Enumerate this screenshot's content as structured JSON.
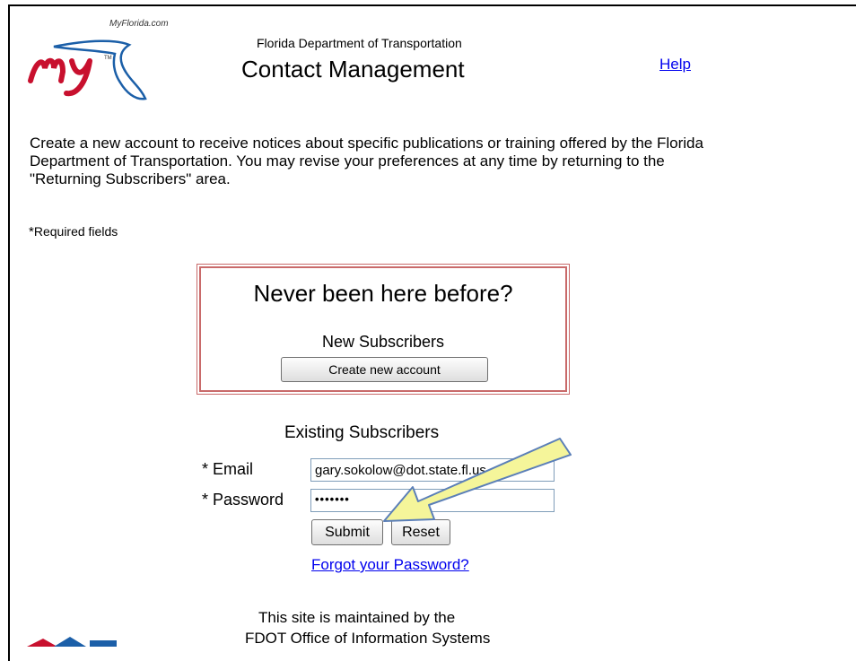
{
  "header": {
    "logo_site": "MyFlorida.com",
    "agency": "Florida Department of Transportation",
    "title": "Contact Management",
    "help_link": "Help"
  },
  "intro": {
    "text": "Create a new account to receive notices about specific publications or training offered by the Florida Department of Transportation. You may revise your preferences at any time by returning to the \"Returning Subscribers\" area."
  },
  "required": {
    "star": "*",
    "label": "Required fields"
  },
  "new_subscribers": {
    "heading": "Never been here before?",
    "subheading": "New Subscribers",
    "create_button": "Create new account"
  },
  "existing_subscribers": {
    "heading": "Existing Subscribers",
    "email_label": "* Email",
    "email_value": "gary.sokolow@dot.state.fl.us",
    "password_label": "* Password",
    "password_value": "•••••••",
    "submit_button": "Submit",
    "reset_button": "Reset",
    "forgot_link": "Forgot your Password?"
  },
  "footer": {
    "line1": "This site is maintained by the",
    "line2": "FDOT Office of Information Systems"
  },
  "colors": {
    "link": "#0000ee",
    "box_border": "#c96a6a",
    "annotation_arrow": "#f5f59a",
    "annotation_arrow_outline": "#5b7fb8"
  }
}
